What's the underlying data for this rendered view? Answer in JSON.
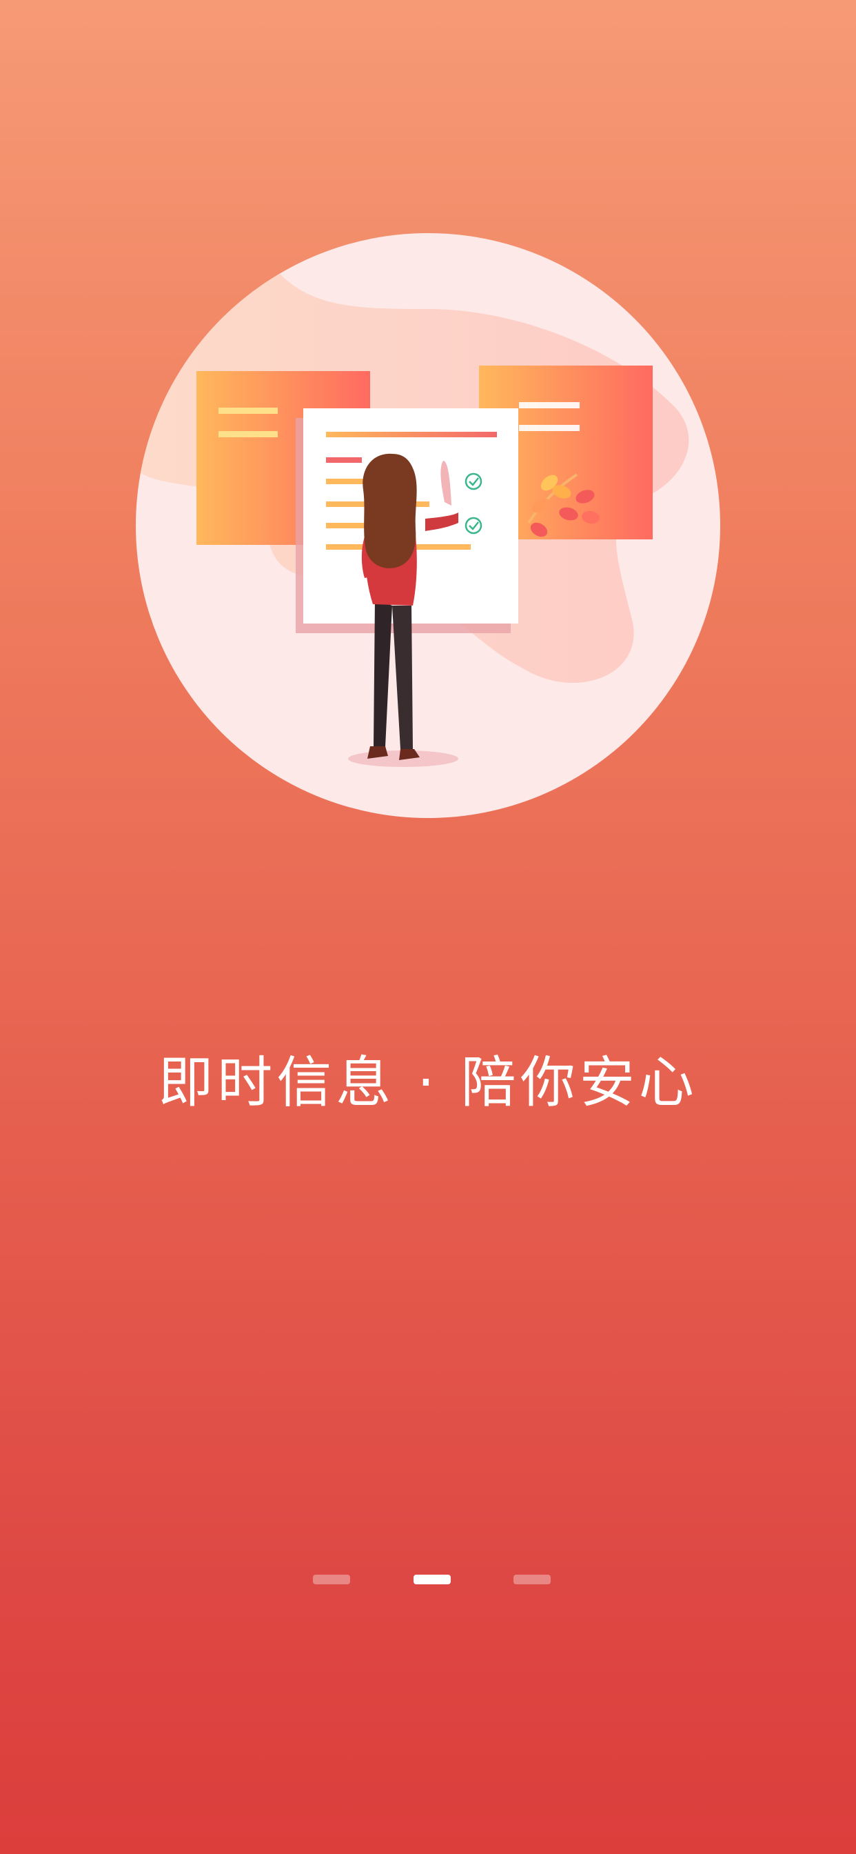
{
  "onboarding": {
    "tagline_left": "即时信息",
    "separator": "·",
    "tagline_right": "陪你安心",
    "illustration_icon": "woman-with-checklist-illustration",
    "pager": {
      "total": 3,
      "active_index": 1
    }
  },
  "colors": {
    "background_top": "#f69a75",
    "background_bottom": "#dc3e3c",
    "text": "#ffffff",
    "check": "#37b78a"
  }
}
